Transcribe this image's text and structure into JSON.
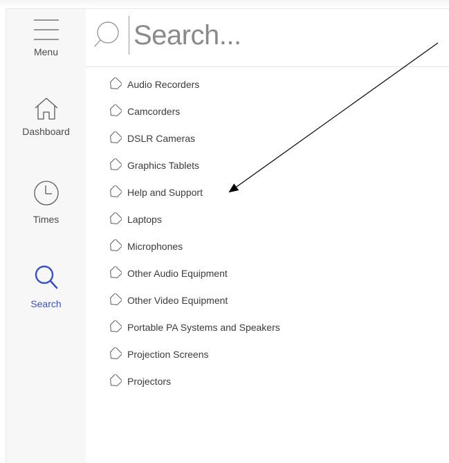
{
  "sidebar": {
    "items": [
      {
        "label": "Menu",
        "icon": "hamburger-icon",
        "active": false
      },
      {
        "label": "Dashboard",
        "icon": "home-icon",
        "active": false
      },
      {
        "label": "Times",
        "icon": "clock-icon",
        "active": false
      },
      {
        "label": "Search",
        "icon": "search-icon",
        "active": true
      }
    ]
  },
  "search": {
    "placeholder": "Search...",
    "icon": "search-icon"
  },
  "categories": [
    {
      "label": "Audio Recorders",
      "icon": "tag-icon"
    },
    {
      "label": "Camcorders",
      "icon": "tag-icon"
    },
    {
      "label": "DSLR Cameras",
      "icon": "tag-icon"
    },
    {
      "label": "Graphics Tablets",
      "icon": "tag-icon"
    },
    {
      "label": "Help and Support",
      "icon": "tag-icon"
    },
    {
      "label": "Laptops",
      "icon": "tag-icon"
    },
    {
      "label": "Microphones",
      "icon": "tag-icon"
    },
    {
      "label": "Other Audio Equipment",
      "icon": "tag-icon"
    },
    {
      "label": "Other Video Equipment",
      "icon": "tag-icon"
    },
    {
      "label": "Portable PA Systems and Speakers",
      "icon": "tag-icon"
    },
    {
      "label": "Projection Screens",
      "icon": "tag-icon"
    },
    {
      "label": "Projectors",
      "icon": "tag-icon"
    }
  ],
  "colors": {
    "accent": "#3a4fc8",
    "sidebar_bg": "#f7f7f7",
    "text": "#3b3b3b",
    "icon_stroke": "#5a5a5a"
  },
  "annotation": {
    "type": "arrow",
    "points_to": "Help and Support"
  }
}
